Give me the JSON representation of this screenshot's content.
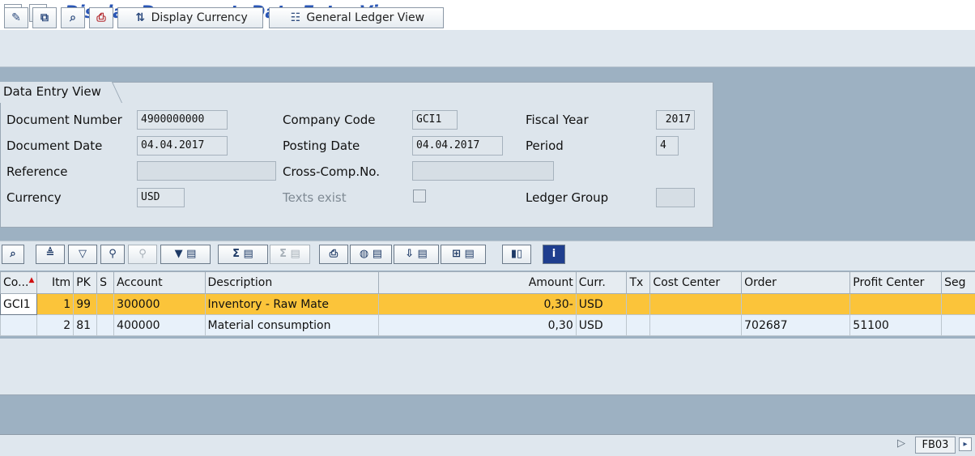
{
  "window": {
    "title": "Display Document: Data Entry View"
  },
  "app_toolbar": {
    "display_currency_label": "Display Currency",
    "general_ledger_view_label": "General Ledger View"
  },
  "header_panel": {
    "tab_label": "Data Entry View",
    "fields": {
      "document_number": {
        "label": "Document Number",
        "value": "4900000000"
      },
      "company_code": {
        "label": "Company Code",
        "value": "GCI1"
      },
      "fiscal_year": {
        "label": "Fiscal Year",
        "value": "2017"
      },
      "document_date": {
        "label": "Document Date",
        "value": "04.04.2017"
      },
      "posting_date": {
        "label": "Posting Date",
        "value": "04.04.2017"
      },
      "period": {
        "label": "Period",
        "value": "4"
      },
      "reference": {
        "label": "Reference",
        "value": ""
      },
      "cross_comp_no": {
        "label": "Cross-Comp.No.",
        "value": ""
      },
      "currency": {
        "label": "Currency",
        "value": "USD"
      },
      "texts_exist": {
        "label": "Texts exist",
        "checked": false
      },
      "ledger_group": {
        "label": "Ledger Group",
        "value": ""
      }
    }
  },
  "line_items": {
    "columns": [
      "Co...",
      "Itm",
      "PK",
      "S",
      "Account",
      "Description",
      "Amount",
      "Curr.",
      "Tx",
      "Cost Center",
      "Order",
      "Profit Center",
      "Seg"
    ],
    "rows": [
      {
        "co": "GCI1",
        "itm": "1",
        "pk": "99",
        "s": "",
        "account": "300000",
        "description": "Inventory - Raw Mate",
        "amount": "0,30-",
        "curr": "USD",
        "tx": "",
        "cost_center": "",
        "order": "",
        "profit_center": "",
        "seg": ""
      },
      {
        "co": "",
        "itm": "2",
        "pk": "81",
        "s": "",
        "account": "400000",
        "description": "Material consumption",
        "amount": "0,30",
        "curr": "USD",
        "tx": "",
        "cost_center": "",
        "order": "702687",
        "profit_center": "51100",
        "seg": ""
      }
    ]
  },
  "status_bar": {
    "transaction_code": "FB03"
  },
  "colors": {
    "title": "#2a56b5",
    "selected_row": "#fbc43a",
    "background": "#9db1c2"
  }
}
